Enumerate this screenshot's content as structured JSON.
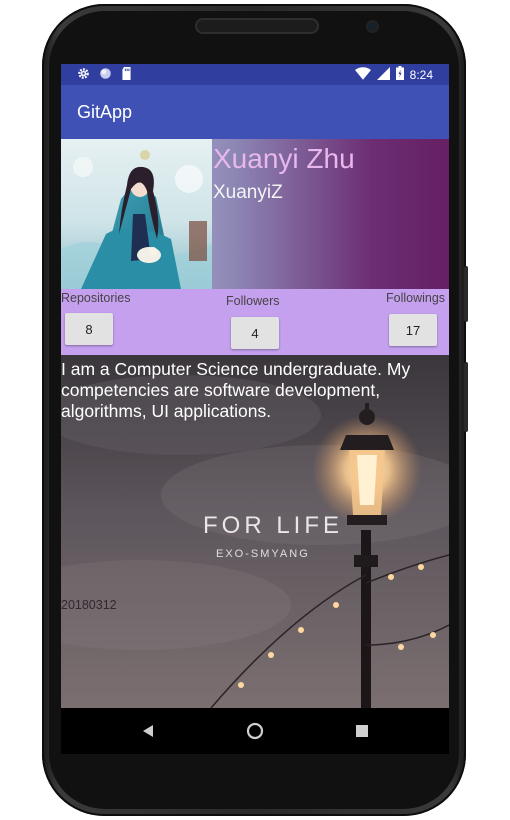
{
  "statusbar": {
    "time": "8:24",
    "left_icons": [
      "gear-icon",
      "circle-icon",
      "sd-card-icon"
    ],
    "right_icons": [
      "wifi-icon",
      "signal-icon",
      "battery-icon"
    ]
  },
  "appbar": {
    "title": "GitApp"
  },
  "profile": {
    "name": "Xuanyi Zhu",
    "login": "XuanyiZ",
    "avatar_icon": "avatar-illustration"
  },
  "stats": {
    "repositories_label": "Repositories",
    "repositories_count": "8",
    "followers_label": "Followers",
    "followers_count": "4",
    "followings_label": "Followings",
    "followings_count": "17"
  },
  "content": {
    "bio": "I am a Computer Science undergraduate. My competencies are software development, algorithms, UI applications.",
    "poster_title": "FOR LIFE",
    "poster_subtitle": "EXO-SMYANG",
    "date": "20180312"
  },
  "navbar": {
    "icons": [
      "back-icon",
      "home-icon",
      "recents-icon"
    ]
  },
  "colors": {
    "statusbar": "#303f9f",
    "appbar": "#3f51b5",
    "stats_background": "#c5a0ef",
    "name_text": "#e8b7ee"
  }
}
